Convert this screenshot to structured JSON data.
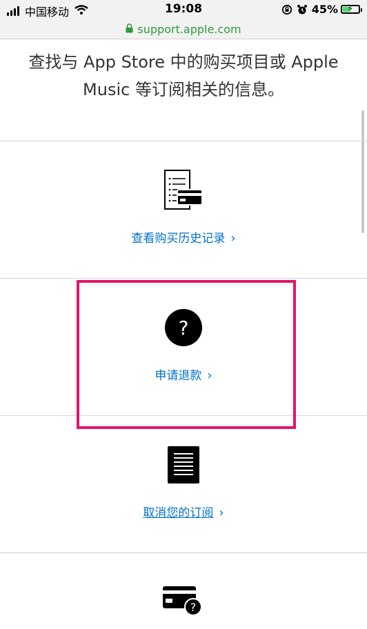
{
  "status_bar": {
    "carrier": "中国移动",
    "time": "19:08",
    "battery_percent": "45%",
    "battery_level": 0.45,
    "battery_color": "#4cd964"
  },
  "url_bar": {
    "url": "support.apple.com",
    "icon": "lock-icon",
    "color": "#2e9b3b"
  },
  "intro_text": "查找与 App Store 中的购买项目或 Apple Music 等订阅相关的信息。",
  "options": [
    {
      "label": "查看购买历史记录",
      "icon": "receipt-card-icon"
    },
    {
      "label": "申请退款",
      "icon": "question-circle-icon"
    },
    {
      "label": "取消您的订阅",
      "icon": "document-list-icon"
    },
    {
      "icon": "card-question-icon"
    }
  ],
  "colors": {
    "link": "#0070c9",
    "highlight": "#e2156b"
  }
}
